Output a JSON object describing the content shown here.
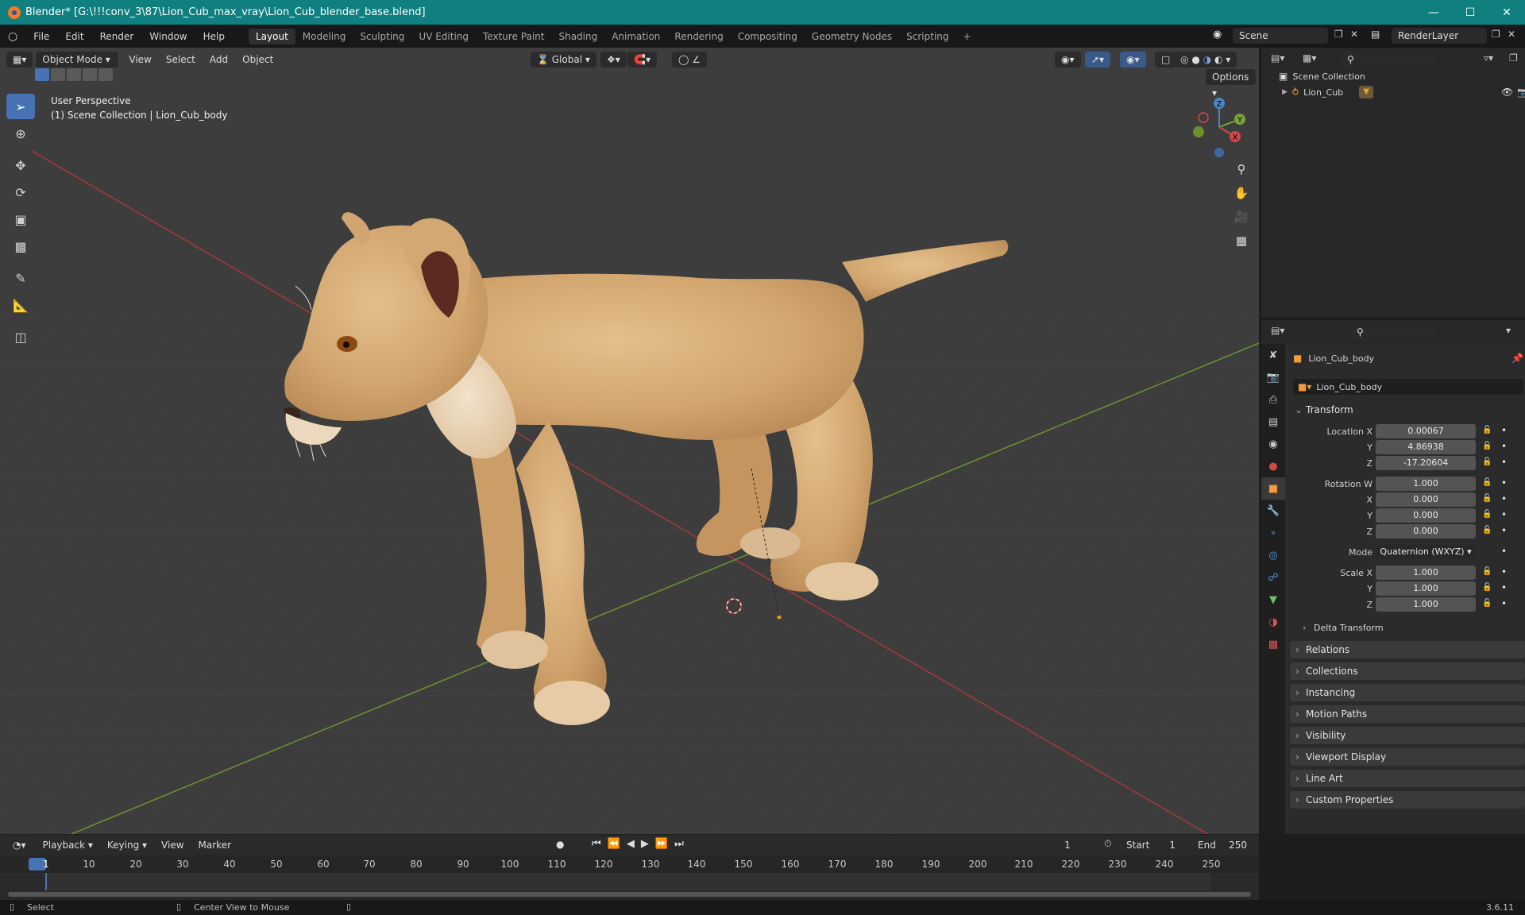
{
  "window": {
    "title": "Blender* [G:\\!!!conv_3\\87\\Lion_Cub_max_vray\\Lion_Cub_blender_base.blend]",
    "controls": [
      "minimize",
      "maximize",
      "close"
    ]
  },
  "topbar": {
    "menus": [
      "File",
      "Edit",
      "Render",
      "Window",
      "Help"
    ],
    "workspaces": [
      "Layout",
      "Modeling",
      "Sculpting",
      "UV Editing",
      "Texture Paint",
      "Shading",
      "Animation",
      "Rendering",
      "Compositing",
      "Geometry Nodes",
      "Scripting"
    ],
    "active_workspace": "Layout",
    "add_tab": "+",
    "scene": "Scene",
    "view_layer": "RenderLayer"
  },
  "viewport": {
    "mode": "Object Mode",
    "menus": [
      "View",
      "Select",
      "Add",
      "Object"
    ],
    "orientation": "Global",
    "options": "Options",
    "overlay_line1": "User Perspective",
    "overlay_line2": "(1) Scene Collection | Lion_Cub_body",
    "gizmo": {
      "x": "X",
      "y": "Y",
      "z": "Z"
    }
  },
  "outliner": {
    "root": "Scene Collection",
    "items": [
      {
        "label": "Lion_Cub"
      }
    ]
  },
  "properties": {
    "object_name": "Lion_Cub_body",
    "object_field": "Lion_Cub_body",
    "transform": {
      "header": "Transform",
      "location_label": "Location X",
      "location": [
        "0.00067",
        "4.86938",
        "-17.20604"
      ],
      "rotation_label": "Rotation W",
      "rotation": [
        "1.000",
        "0.000",
        "0.000",
        "0.000"
      ],
      "mode_label": "Mode",
      "mode": "Quaternion (WXYZ)",
      "scale_label": "Scale X",
      "scale": [
        "1.000",
        "1.000",
        "1.000"
      ],
      "axis_y": "Y",
      "axis_z": "Z",
      "axis_x": "X",
      "delta": "Delta Transform"
    },
    "sections": [
      "Relations",
      "Collections",
      "Instancing",
      "Motion Paths",
      "Visibility",
      "Viewport Display",
      "Line Art",
      "Custom Properties"
    ]
  },
  "timeline": {
    "menus": [
      "Playback",
      "Keying",
      "View",
      "Marker"
    ],
    "current_frame": "1",
    "start_label": "Start",
    "start": "1",
    "end_label": "End",
    "end": "250",
    "ticks": [
      "1",
      "10",
      "20",
      "30",
      "40",
      "50",
      "60",
      "70",
      "80",
      "90",
      "100",
      "110",
      "120",
      "130",
      "140",
      "150",
      "160",
      "170",
      "180",
      "190",
      "200",
      "210",
      "220",
      "230",
      "240",
      "250"
    ]
  },
  "statusbar": {
    "left": "Select",
    "middle": "Center View to Mouse",
    "version": "3.6.11"
  },
  "colors": {
    "accent": "#4772b3",
    "titlebar": "#0f7f80",
    "x_axis": "#d04848",
    "y_axis": "#7aa33c",
    "z_axis": "#4a86c8"
  }
}
